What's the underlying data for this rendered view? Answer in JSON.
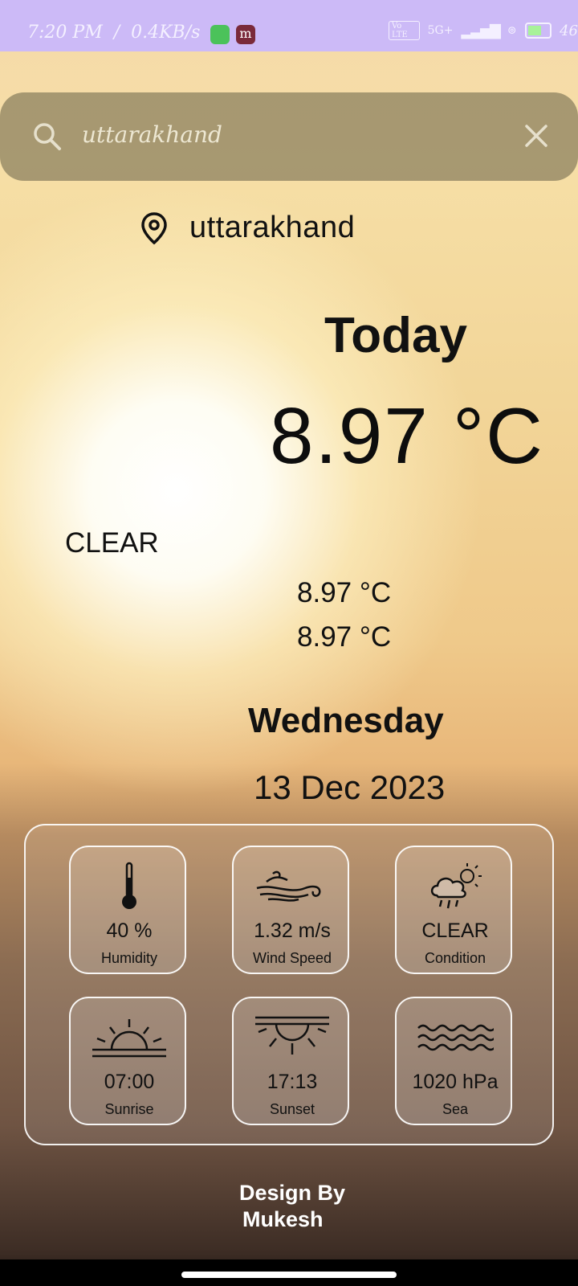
{
  "status_bar": {
    "time": "7:20 PM",
    "speed": "0.4KB/s",
    "network_chip": "Vo LTE",
    "network": "5G+",
    "battery": "46"
  },
  "search": {
    "icon": "search-icon",
    "value": "uttarakhand",
    "clear_icon": "close-icon"
  },
  "location": {
    "icon": "location-pin-icon",
    "name": "uttarakhand"
  },
  "today_label": "Today",
  "temperature": "8.97 °C",
  "condition": "CLEAR",
  "temp_min": "8.97 °C",
  "temp_max": "8.97 °C",
  "weekday": "Wednesday",
  "date": "13 Dec 2023",
  "details": [
    {
      "icon": "thermometer-icon",
      "value": "40 %",
      "label": "Humidity"
    },
    {
      "icon": "wind-icon",
      "value": "1.32 m/s",
      "label": "Wind Speed"
    },
    {
      "icon": "cloud-sun-rain-icon",
      "value": "CLEAR",
      "label": "Condition"
    },
    {
      "icon": "sunrise-icon",
      "value": "07:00",
      "label": "Sunrise"
    },
    {
      "icon": "sunset-icon",
      "value": "17:13",
      "label": "Sunset"
    },
    {
      "icon": "waves-icon",
      "value": "1020 hPa",
      "label": "Sea"
    }
  ],
  "credit": {
    "line1": "Design By",
    "line2": "Mukesh"
  },
  "colors": {
    "status_bar": "#ccbaf7",
    "search_bg": "#766e50",
    "text": "#111111"
  }
}
